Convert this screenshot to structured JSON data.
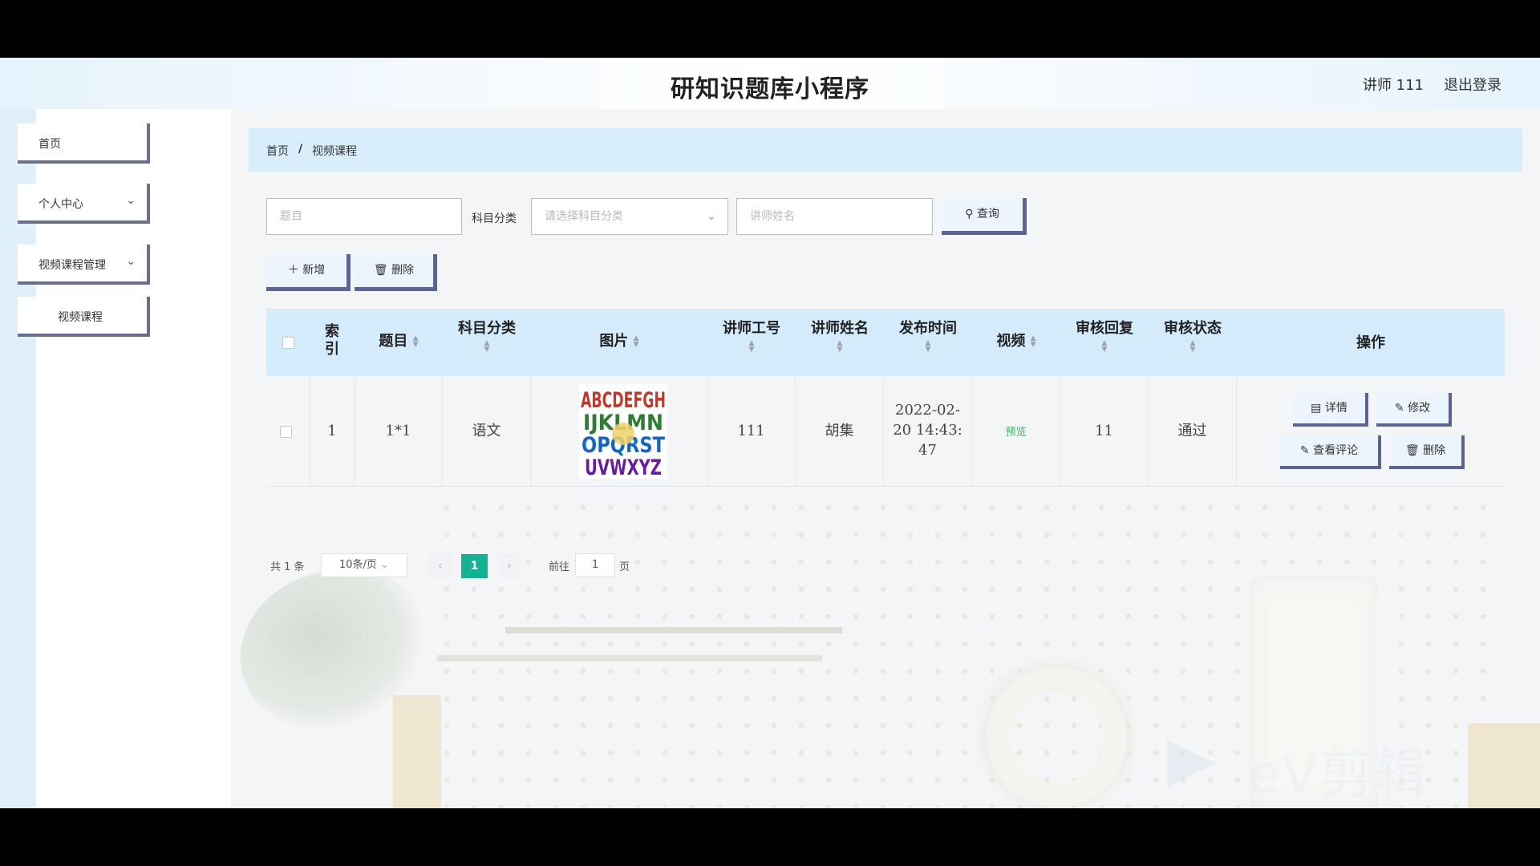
{
  "header": {
    "title": "研知识题库小程序",
    "user": "讲师 111",
    "logout": "退出登录"
  },
  "sidebar": {
    "items": [
      {
        "label": "首页",
        "has_chevron": false
      },
      {
        "label": "个人中心",
        "has_chevron": true
      },
      {
        "label": "视频课程管理",
        "has_chevron": true
      },
      {
        "label": "视频课程",
        "has_chevron": false
      }
    ]
  },
  "breadcrumb": {
    "home": "首页",
    "sep": "/",
    "current": "视频课程"
  },
  "search": {
    "title_placeholder": "题目",
    "category_label": "科目分类",
    "category_placeholder": "请选择科目分类",
    "teacher_placeholder": "讲师姓名",
    "query_label": "查询"
  },
  "toolbar": {
    "add_label": "新增",
    "delete_label": "删除"
  },
  "table": {
    "headers": {
      "index": "索引",
      "title": "题目",
      "category": "科目分类",
      "image": "图片",
      "teacher_id": "讲师工号",
      "teacher_name": "讲师姓名",
      "publish_time": "发布时间",
      "video": "视频",
      "review_reply": "审核回复",
      "review_status": "审核状态",
      "actions": "操作"
    },
    "rows": [
      {
        "index": "1",
        "title": "1*1",
        "category": "语文",
        "teacher_id": "111",
        "teacher_name": "胡集",
        "publish_time": "2022-02-20 14:43:47",
        "video": "预览",
        "review_reply": "11",
        "review_status": "通过",
        "image_letters": [
          "ABCDEFGH",
          "IJKLMN",
          "OPQRST",
          "UVWXYZ"
        ]
      }
    ],
    "actions": {
      "detail": "详情",
      "edit": "修改",
      "comments": "查看评论",
      "delete": "删除"
    }
  },
  "pagination": {
    "total": "共 1 条",
    "page_size": "10条/页",
    "current_page": "1",
    "goto_label": "前往",
    "goto_value": "1",
    "page_suffix": "页"
  },
  "watermark": {
    "text": "eV剪辑"
  },
  "colors": {
    "accent": "#14b292",
    "header_bg": "#d4ebfc",
    "button_border": "#5b6390",
    "preview": "#39b36a"
  }
}
